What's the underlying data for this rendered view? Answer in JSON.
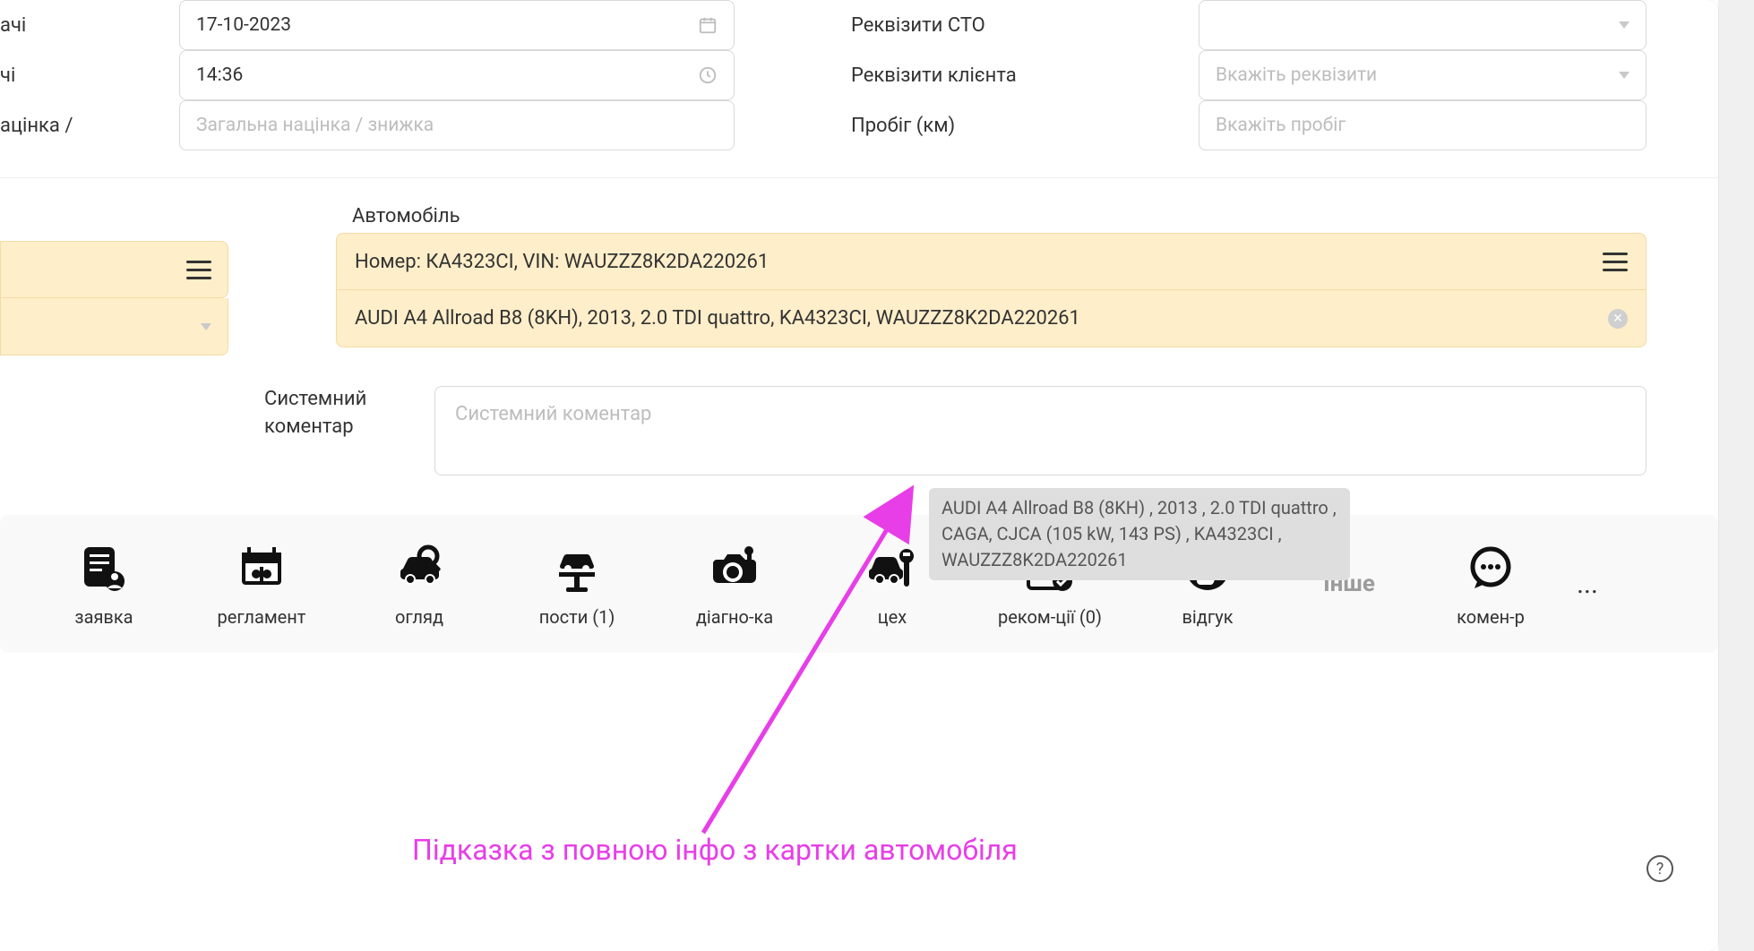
{
  "form": {
    "leftLabels": {
      "row1": "ачі",
      "row2": "чі",
      "row3": "ацінка /"
    },
    "rightLabels": {
      "row1": "Реквізити СТО",
      "row2": "Реквізити клієнта",
      "row3": "Пробіг (км)"
    },
    "date": "17-10-2023",
    "time": "14:36",
    "markupPlaceholder": "Загальна націнка / знижка",
    "clientReqPlaceholder": "Вкажіть реквізити",
    "mileagePlaceholder": "Вкажіть пробіг"
  },
  "vehicle": {
    "sectionTitle": "Автомобіль",
    "header": "Номер: КА4323СІ,  VIN: WAUZZZ8K2DA220261",
    "selected": "AUDI A4 Allroad B8 (8KH), 2013, 2.0 TDI quattro, KA4323CI, WAUZZZ8K2DA220261",
    "tooltip": "AUDI A4 Allroad B8 (8KH) , 2013 , 2.0 TDI quattro , CAGA, CJCA (105 kW, 143 PS) , KA4323CI , WAUZZZ8K2DA220261"
  },
  "sysComment": {
    "label1": "Системний",
    "label2": "коментар",
    "placeholder": "Системний коментар"
  },
  "tabs": [
    {
      "key": "application",
      "label": "заявка"
    },
    {
      "key": "reglament",
      "label": "регламент"
    },
    {
      "key": "inspection",
      "label": "огляд"
    },
    {
      "key": "posts",
      "label": "пости (1)"
    },
    {
      "key": "diagnostics",
      "label": "діагно-ка"
    },
    {
      "key": "workshop",
      "label": "цех"
    },
    {
      "key": "recommendations",
      "label": "реком-ції (0)"
    },
    {
      "key": "feedback",
      "label": "відгук"
    },
    {
      "key": "other",
      "label": "Інше"
    },
    {
      "key": "comments",
      "label": "комен-р"
    }
  ],
  "caption": "Підказка з повною інфо з картки автомобіля",
  "misc": {
    "dots": "...",
    "helpQ": "?",
    "clearX": "✕"
  }
}
